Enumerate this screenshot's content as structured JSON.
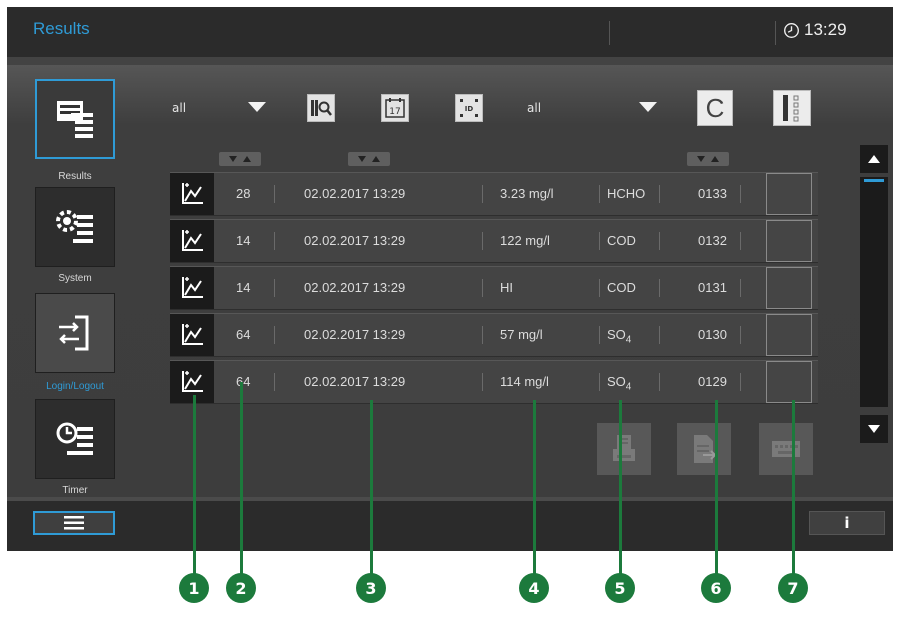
{
  "app": {
    "title": "Results",
    "time": "13:29"
  },
  "sidebar": {
    "items": [
      {
        "label": "Results",
        "icon": "results-list-icon",
        "active": true
      },
      {
        "label": "System",
        "icon": "gear-list-icon"
      },
      {
        "label": "Login/Logout",
        "icon": "login-logout-icon"
      },
      {
        "label": "Timer",
        "icon": "timer-list-icon"
      }
    ]
  },
  "toolbar": {
    "filter1_value": "all",
    "filter2_value": "all",
    "search_icon": "search-sample-icon",
    "calendar_icon": "calendar-icon",
    "calendar_day": "17",
    "id_icon": "id-scan-icon",
    "id_label": "ID",
    "clear_label": "C",
    "columns_icon": "column-select-icon"
  },
  "table": {
    "rows": [
      {
        "no": "28",
        "datetime": "02.02.2017 13:29",
        "value": "3.23 mg/l",
        "param": "HCHO",
        "param_sub": "",
        "id": "0133"
      },
      {
        "no": "14",
        "datetime": "02.02.2017 13:29",
        "value": "122 mg/l",
        "param": "COD",
        "param_sub": "",
        "id": "0132"
      },
      {
        "no": "14",
        "datetime": "02.02.2017 13:29",
        "value": "HI",
        "param": "COD",
        "param_sub": "",
        "id": "0131"
      },
      {
        "no": "64",
        "datetime": "02.02.2017 13:29",
        "value": "57 mg/l",
        "param": "SO",
        "param_sub": "4",
        "id": "0130"
      },
      {
        "no": "64",
        "datetime": "02.02.2017 13:29",
        "value": "114 mg/l",
        "param": "SO",
        "param_sub": "4",
        "id": "0129"
      }
    ]
  },
  "actions": {
    "print_icon": "print-icon",
    "export_icon": "export-document-icon",
    "keyboard_icon": "keyboard-icon"
  },
  "footer": {
    "menu_icon": "menu-icon",
    "info_label": "i"
  },
  "callouts": [
    "1",
    "2",
    "3",
    "4",
    "5",
    "6",
    "7"
  ],
  "colors": {
    "accent": "#2f9bd6",
    "callout": "#1c7a3c"
  }
}
